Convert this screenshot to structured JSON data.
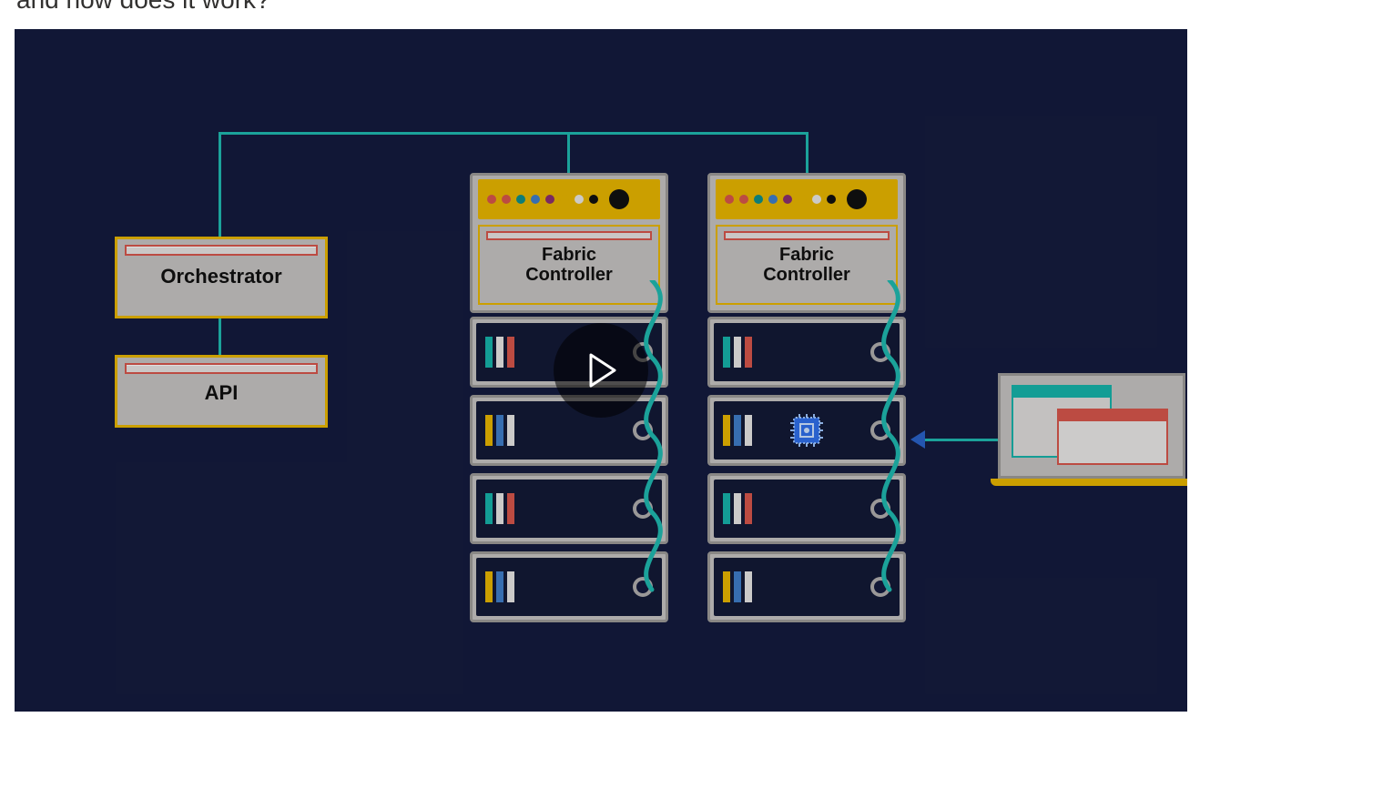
{
  "heading_fragment": "and how does it work?",
  "diagram": {
    "orchestrator_label": "Orchestrator",
    "api_label": "API",
    "fabric_controller_label_line1": "Fabric",
    "fabric_controller_label_line2": "Controller",
    "switch_dot_colors": [
      "#d6564c",
      "#d6564c",
      "#0f8f88",
      "#3f7ec9",
      "#8a2f6f",
      "#e8b500",
      "#e8e6e5",
      "#111"
    ],
    "switch_big_dot": "#111",
    "server_bar_palettes": {
      "teal_white_red": [
        "#16b3aa",
        "#e8e6e5",
        "#d6564c"
      ],
      "yellow_blue_white": [
        "#e8b500",
        "#3f7ec9",
        "#e8e6e5"
      ]
    },
    "rack1_rows": [
      "teal_white_red",
      "yellow_blue_white",
      "teal_white_red",
      "yellow_blue_white"
    ],
    "rack2_rows": [
      "teal_white_red",
      "yellow_blue_white",
      "teal_white_red",
      "yellow_blue_white"
    ],
    "vm_chip_row_rack2": 1
  },
  "play_button_label": "Play video"
}
